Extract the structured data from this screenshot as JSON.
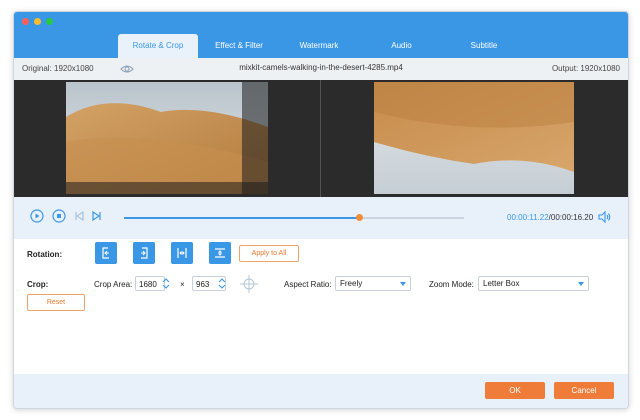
{
  "tabs": [
    {
      "label": "Rotate & Crop",
      "active": true
    },
    {
      "label": "Effect & Filter",
      "active": false
    },
    {
      "label": "Watermark",
      "active": false
    },
    {
      "label": "Audio",
      "active": false
    },
    {
      "label": "Subtitle",
      "active": false
    }
  ],
  "infobar": {
    "original": "Original: 1920x1080",
    "filename": "mixkit-camels-walking-in-the-desert-4285.mp4",
    "output": "Output: 1920x1080"
  },
  "playback": {
    "current_time": "00:00:11.22",
    "total_time": "/00:00:16.20",
    "progress": 0.69
  },
  "rotation": {
    "label": "Rotation:",
    "buttons": [
      {
        "icon": "rotate-left-icon"
      },
      {
        "icon": "rotate-right-icon"
      },
      {
        "icon": "flip-horizontal-icon"
      },
      {
        "icon": "flip-vertical-icon"
      }
    ],
    "apply_label": "Apply to All"
  },
  "crop": {
    "label": "Crop:",
    "area_label": "Crop Area:",
    "width": "1680",
    "times": "×",
    "height": "963",
    "aspect_label": "Aspect Ratio:",
    "aspect_value": "Freely",
    "zoom_label": "Zoom Mode:",
    "zoom_value": "Letter Box",
    "reset_label": "Reset"
  },
  "footer": {
    "ok_label": "OK",
    "cancel_label": "Cancel"
  },
  "colors": {
    "accent": "#3a97e6",
    "orange": "#f07c3a"
  }
}
